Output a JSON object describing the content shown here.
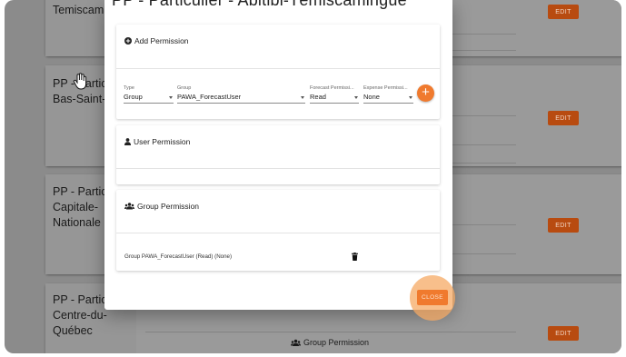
{
  "background": {
    "cards": [
      {
        "title": "Temiscam",
        "edit_label": "EDIT"
      },
      {
        "title": "PP - Partic Bas-Saint-",
        "edit_label": "EDIT"
      },
      {
        "title": "PP - Partic Capitale- Nationale",
        "edit_label": "EDIT"
      },
      {
        "title": "PP - Partic Centre-du- Québec",
        "edit_label": "EDIT"
      }
    ],
    "group_permission_label": "Group Permission"
  },
  "modal": {
    "title": "PP - Particulier - Abitibi-Témiscamingue",
    "add_permission": {
      "heading": "Add Permission",
      "type": {
        "label": "Type",
        "value": "Group"
      },
      "group": {
        "label": "Group",
        "value": "PAWA_ForecastUser"
      },
      "forecast": {
        "label": "Forecast Permissi...",
        "value": "Read"
      },
      "expense": {
        "label": "Expense Permissi...",
        "value": "None"
      },
      "add_button": "+"
    },
    "user_permission": {
      "heading": "User Permission"
    },
    "group_permission": {
      "heading": "Group Permission",
      "rows": [
        {
          "text": "Group PAWA_ForecastUser (Read) (None)"
        }
      ]
    },
    "close_label": "CLOSE"
  },
  "colors": {
    "accent": "#f07a2e",
    "edit_button": "#b84b10"
  }
}
